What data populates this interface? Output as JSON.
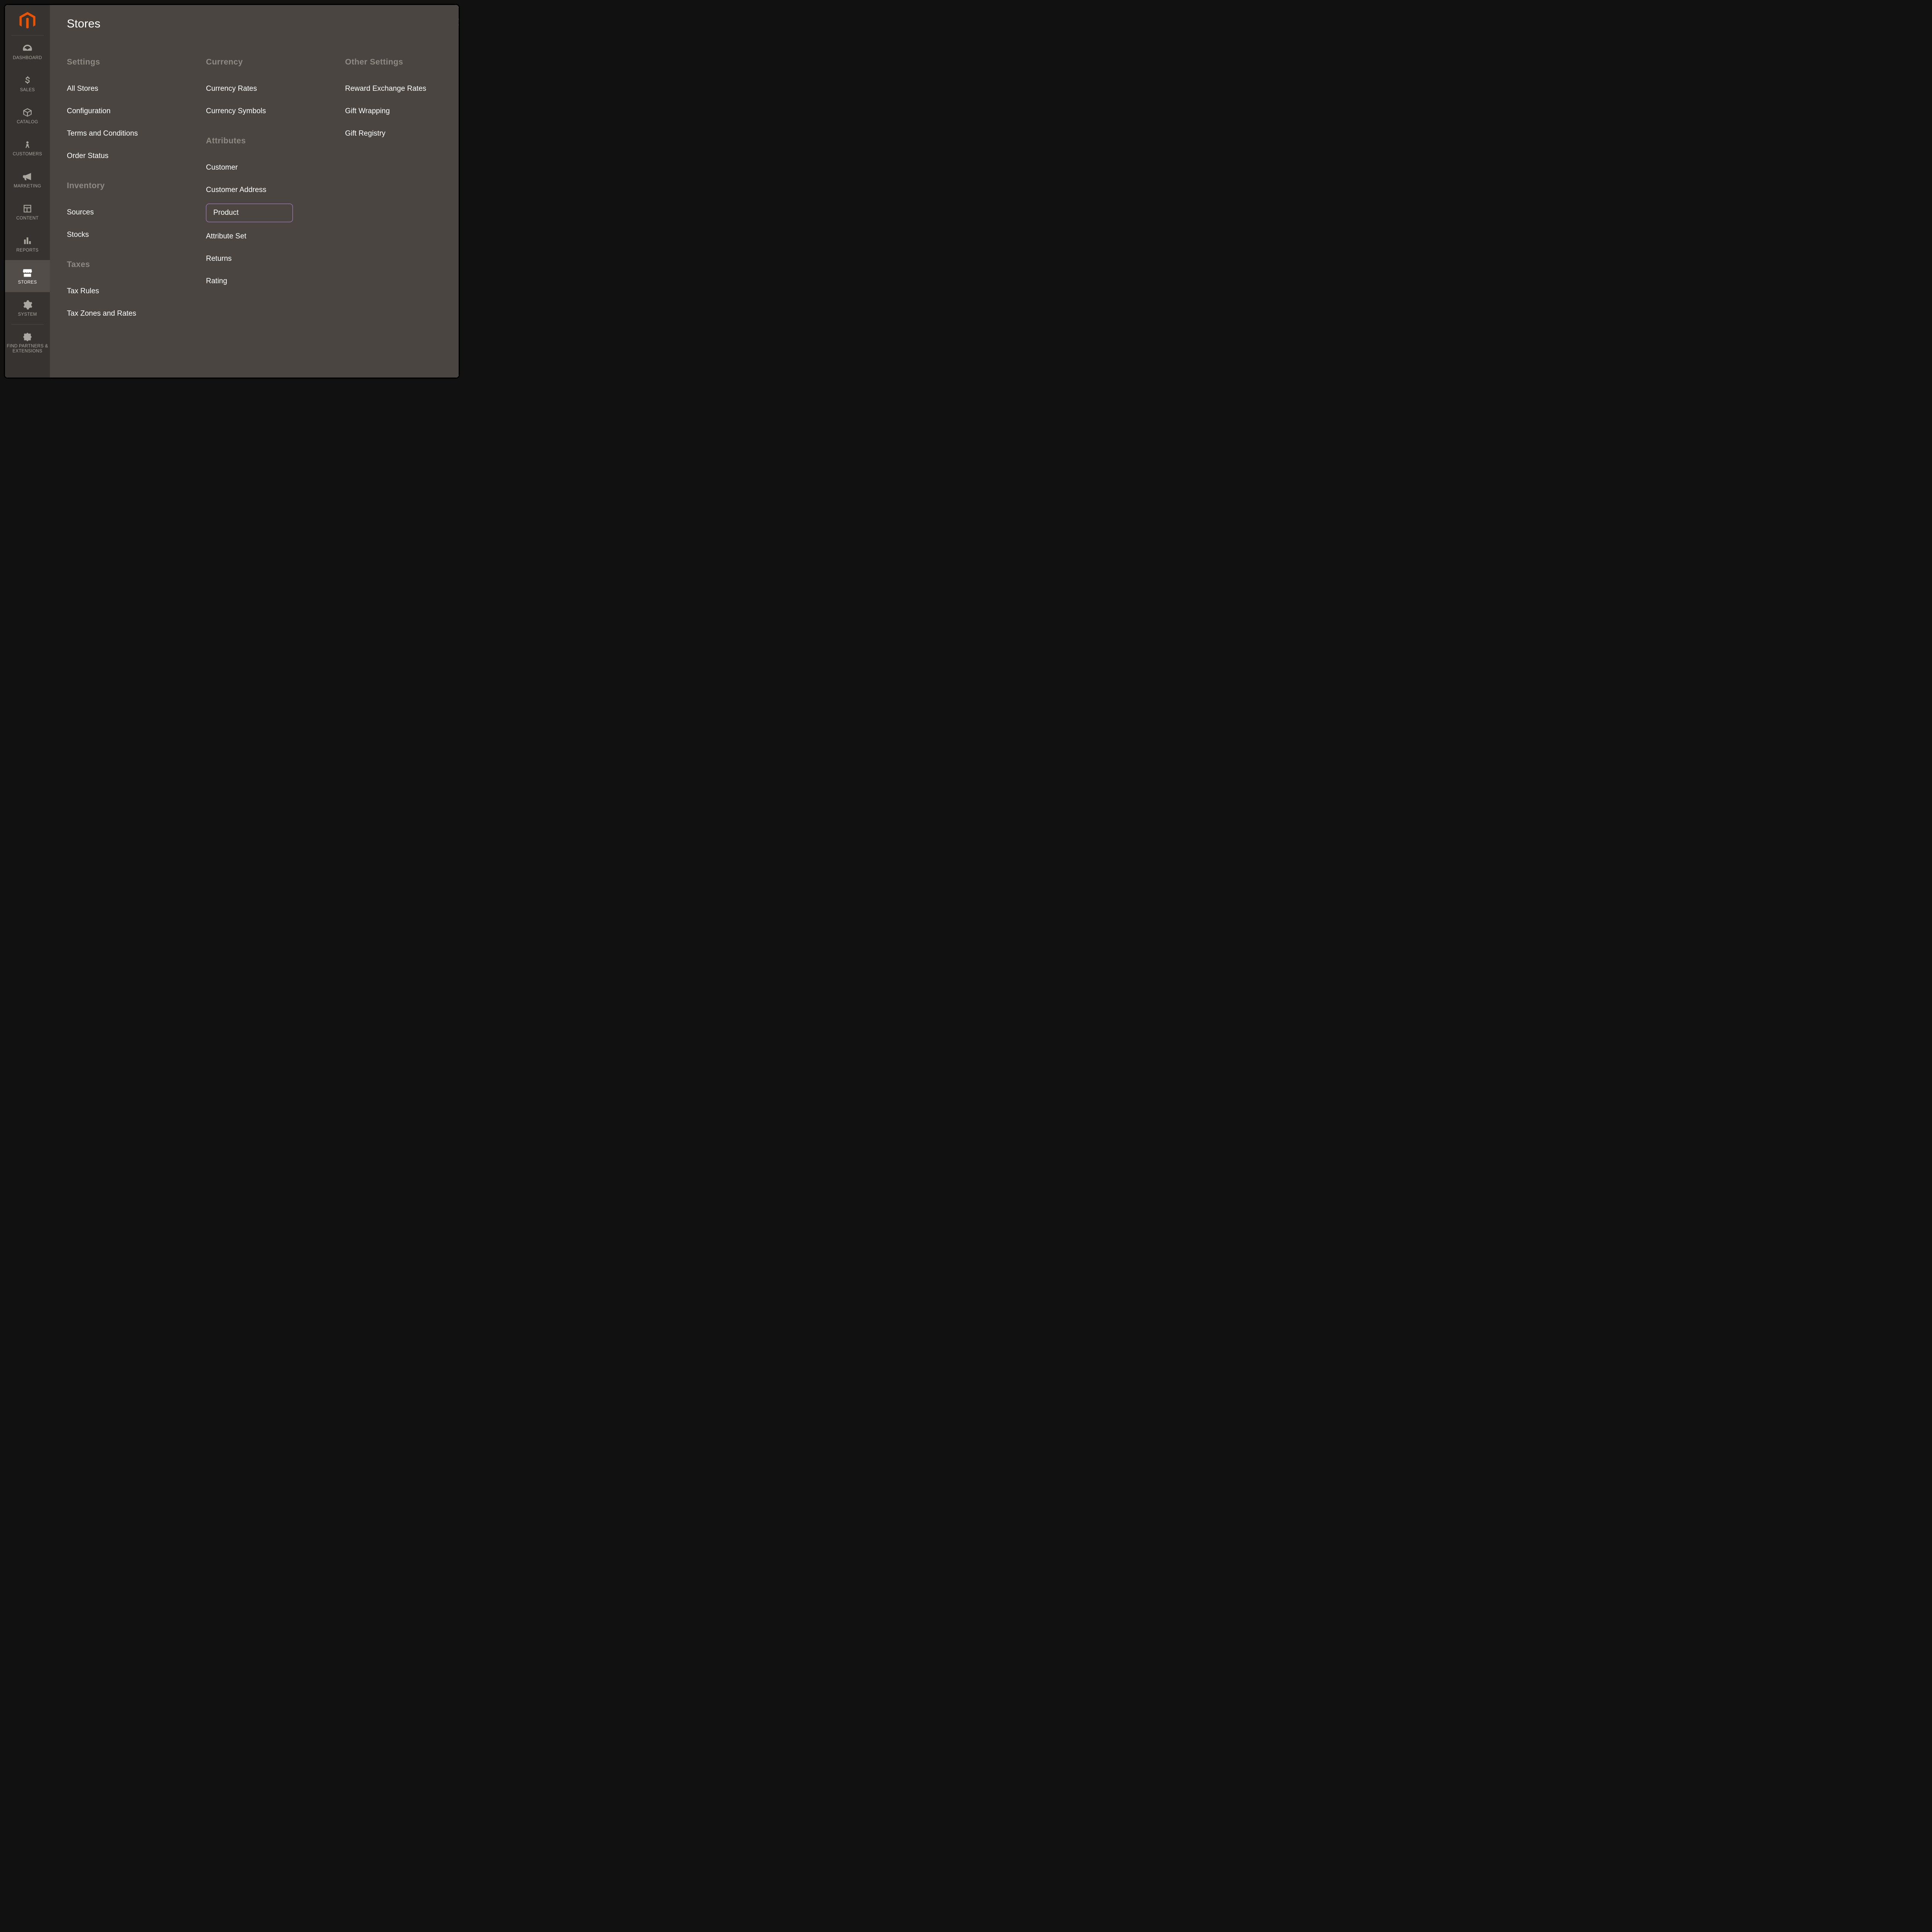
{
  "sidebar": {
    "items": [
      {
        "id": "dashboard",
        "label": "DASHBOARD"
      },
      {
        "id": "sales",
        "label": "SALES"
      },
      {
        "id": "catalog",
        "label": "CATALOG"
      },
      {
        "id": "customers",
        "label": "CUSTOMERS"
      },
      {
        "id": "marketing",
        "label": "MARKETING"
      },
      {
        "id": "content",
        "label": "CONTENT"
      },
      {
        "id": "reports",
        "label": "REPORTS"
      },
      {
        "id": "stores",
        "label": "STORES"
      },
      {
        "id": "system",
        "label": "SYSTEM"
      },
      {
        "id": "partners",
        "label": "FIND PARTNERS & EXTENSIONS"
      }
    ],
    "active": "stores"
  },
  "flyout": {
    "title": "Stores",
    "columns": [
      {
        "groups": [
          {
            "title": "Settings",
            "items": [
              {
                "label": "All Stores"
              },
              {
                "label": "Configuration"
              },
              {
                "label": "Terms and Conditions"
              },
              {
                "label": "Order Status"
              }
            ]
          },
          {
            "title": "Inventory",
            "items": [
              {
                "label": "Sources"
              },
              {
                "label": "Stocks"
              }
            ]
          },
          {
            "title": "Taxes",
            "items": [
              {
                "label": "Tax Rules"
              },
              {
                "label": "Tax Zones and Rates"
              }
            ]
          }
        ]
      },
      {
        "groups": [
          {
            "title": "Currency",
            "items": [
              {
                "label": "Currency Rates"
              },
              {
                "label": "Currency Symbols"
              }
            ]
          },
          {
            "title": "Attributes",
            "items": [
              {
                "label": "Customer"
              },
              {
                "label": "Customer Address"
              },
              {
                "label": "Product",
                "highlight": true
              },
              {
                "label": "Attribute Set"
              },
              {
                "label": "Returns"
              },
              {
                "label": "Rating"
              }
            ]
          }
        ]
      },
      {
        "groups": [
          {
            "title": "Other Settings",
            "items": [
              {
                "label": "Reward Exchange Rates"
              },
              {
                "label": "Gift Wrapping"
              },
              {
                "label": "Gift Registry"
              }
            ]
          }
        ]
      }
    ]
  },
  "colors": {
    "brand_orange": "#eb5202",
    "sidebar_bg": "#363330",
    "flyout_bg": "#4a4540",
    "highlight_border": "#b889d6"
  }
}
